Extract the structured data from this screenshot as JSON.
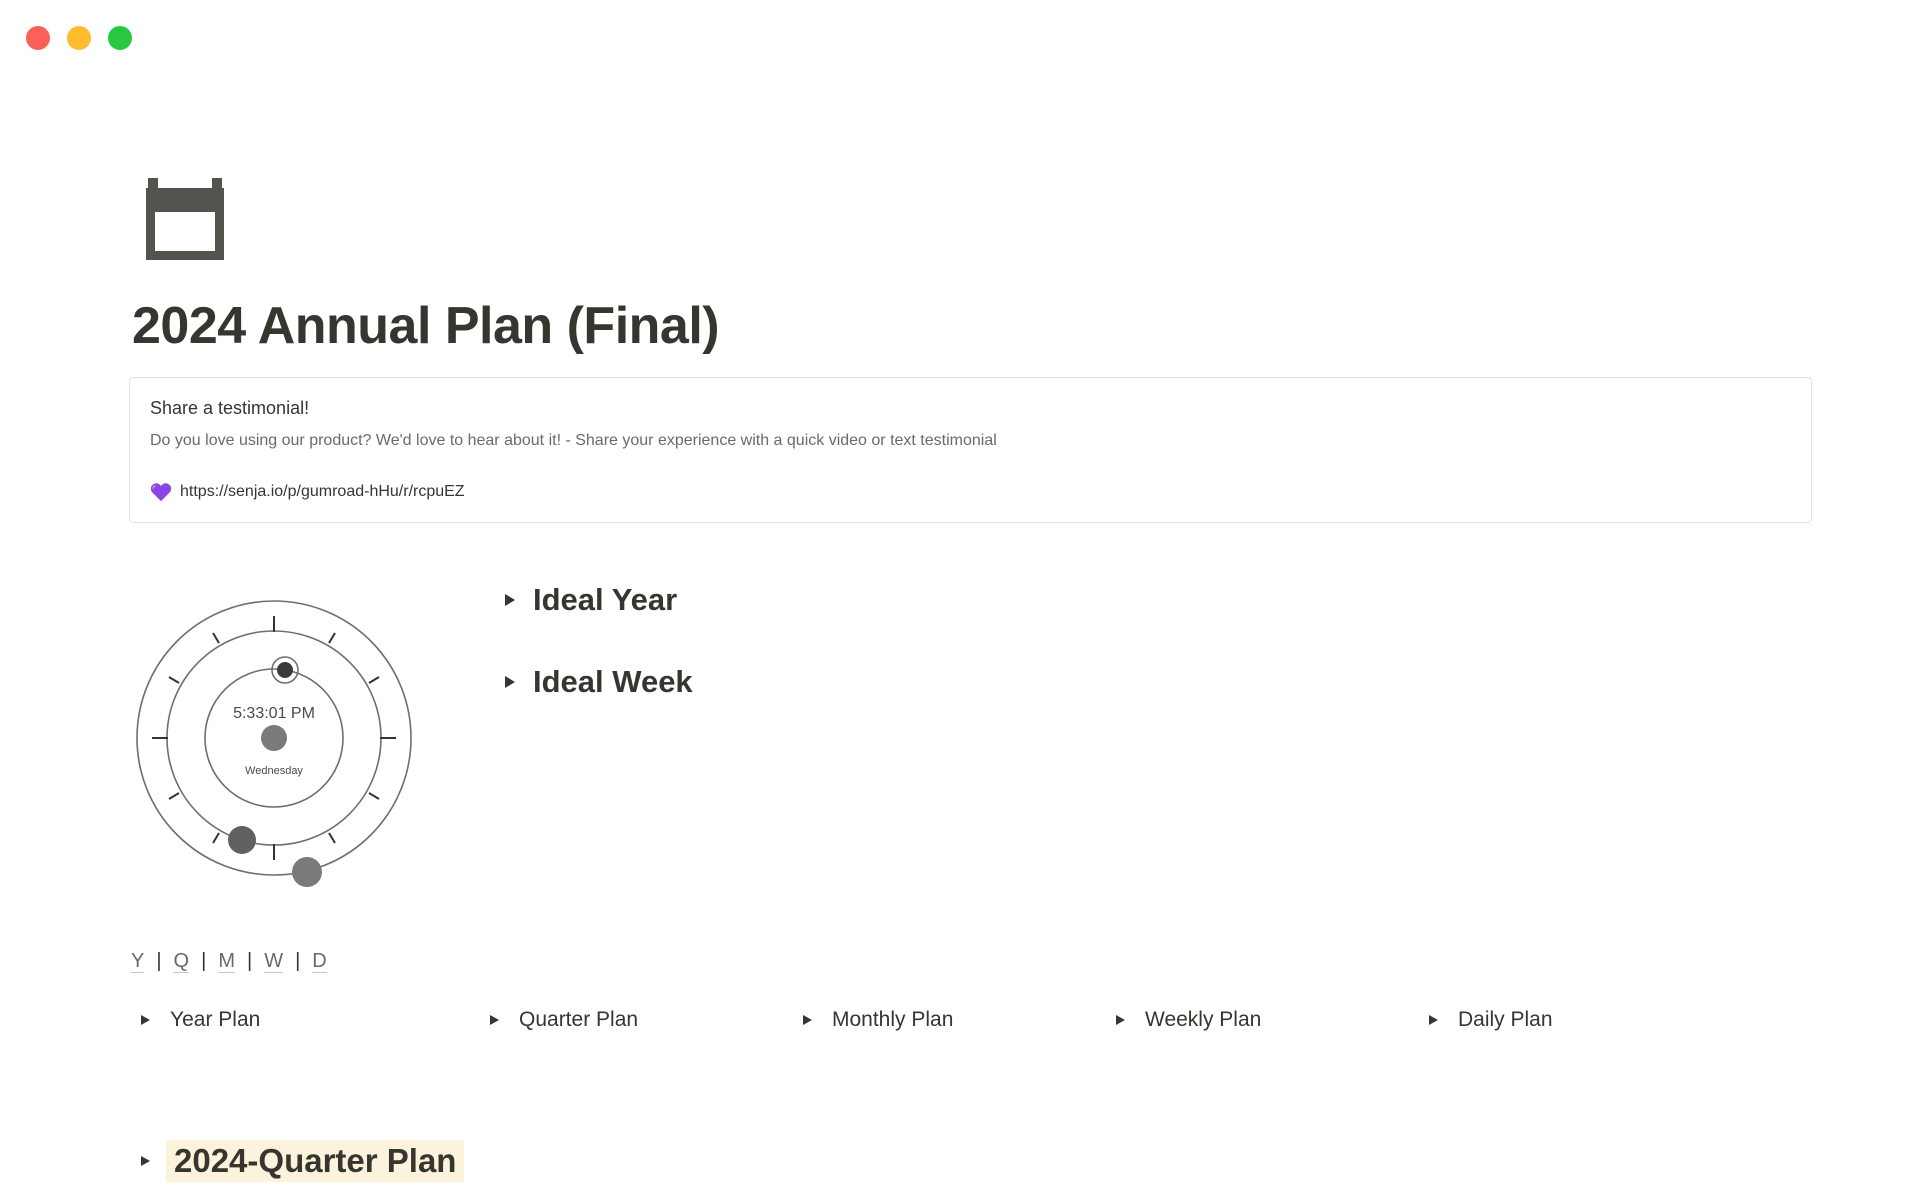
{
  "window": {
    "controls": [
      "close",
      "minimize",
      "zoom"
    ]
  },
  "page": {
    "icon": "calendar-icon",
    "title": "2024 Annual Plan (Final)"
  },
  "callout": {
    "title": "Share a testimonial!",
    "description": "Do you love using our product? We'd love to hear about it! - Share your experience with a quick video or text testimonial",
    "link_icon": "purple-heart-icon",
    "link_text": "https://senja.io/p/gumroad-hHu/r/rcpuEZ"
  },
  "clock": {
    "time": "5:33:01 PM",
    "day": "Wednesday"
  },
  "toggles": {
    "ideal_year": "Ideal Year",
    "ideal_week": "Ideal Week"
  },
  "nav": {
    "items": [
      "Y",
      "Q",
      "M",
      "W",
      "D"
    ],
    "separator": "|"
  },
  "plans": [
    "Year Plan",
    "Quarter Plan",
    "Monthly Plan",
    "Weekly Plan",
    "Daily Plan"
  ],
  "quarter_section": {
    "label": "2024-Quarter Plan"
  },
  "colors": {
    "text": "#37352f",
    "muted": "#6b6a66",
    "highlight": "#fbf3db",
    "close": "#fe5f57",
    "minimize": "#febc2e",
    "zoom": "#28c840"
  }
}
